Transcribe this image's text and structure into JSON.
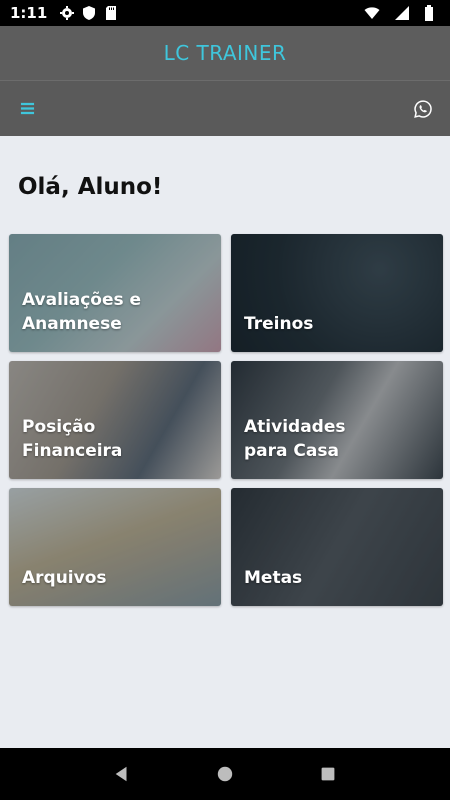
{
  "status_bar": {
    "time": "1:11",
    "left_icons": [
      "gear-icon",
      "shield-icon",
      "sd-card-icon"
    ],
    "right_icons": [
      "wifi-icon",
      "signal-icon",
      "battery-icon"
    ]
  },
  "app_bar": {
    "title": "LC TRAINER",
    "title_color": "#3fc6dc"
  },
  "toolbar": {
    "menu_icon": "hamburger-menu-icon",
    "whatsapp_icon": "whatsapp-icon"
  },
  "main": {
    "greeting": "Olá, Aluno!",
    "cards": [
      {
        "label": "Avaliações e\nAnamnese"
      },
      {
        "label": "Treinos"
      },
      {
        "label": "Posição\nFinanceira"
      },
      {
        "label": "Atividades\npara Casa"
      },
      {
        "label": "Arquivos"
      },
      {
        "label": "Metas"
      }
    ]
  },
  "nav_bar": {
    "buttons": [
      "back-icon",
      "home-icon",
      "recents-icon"
    ]
  }
}
